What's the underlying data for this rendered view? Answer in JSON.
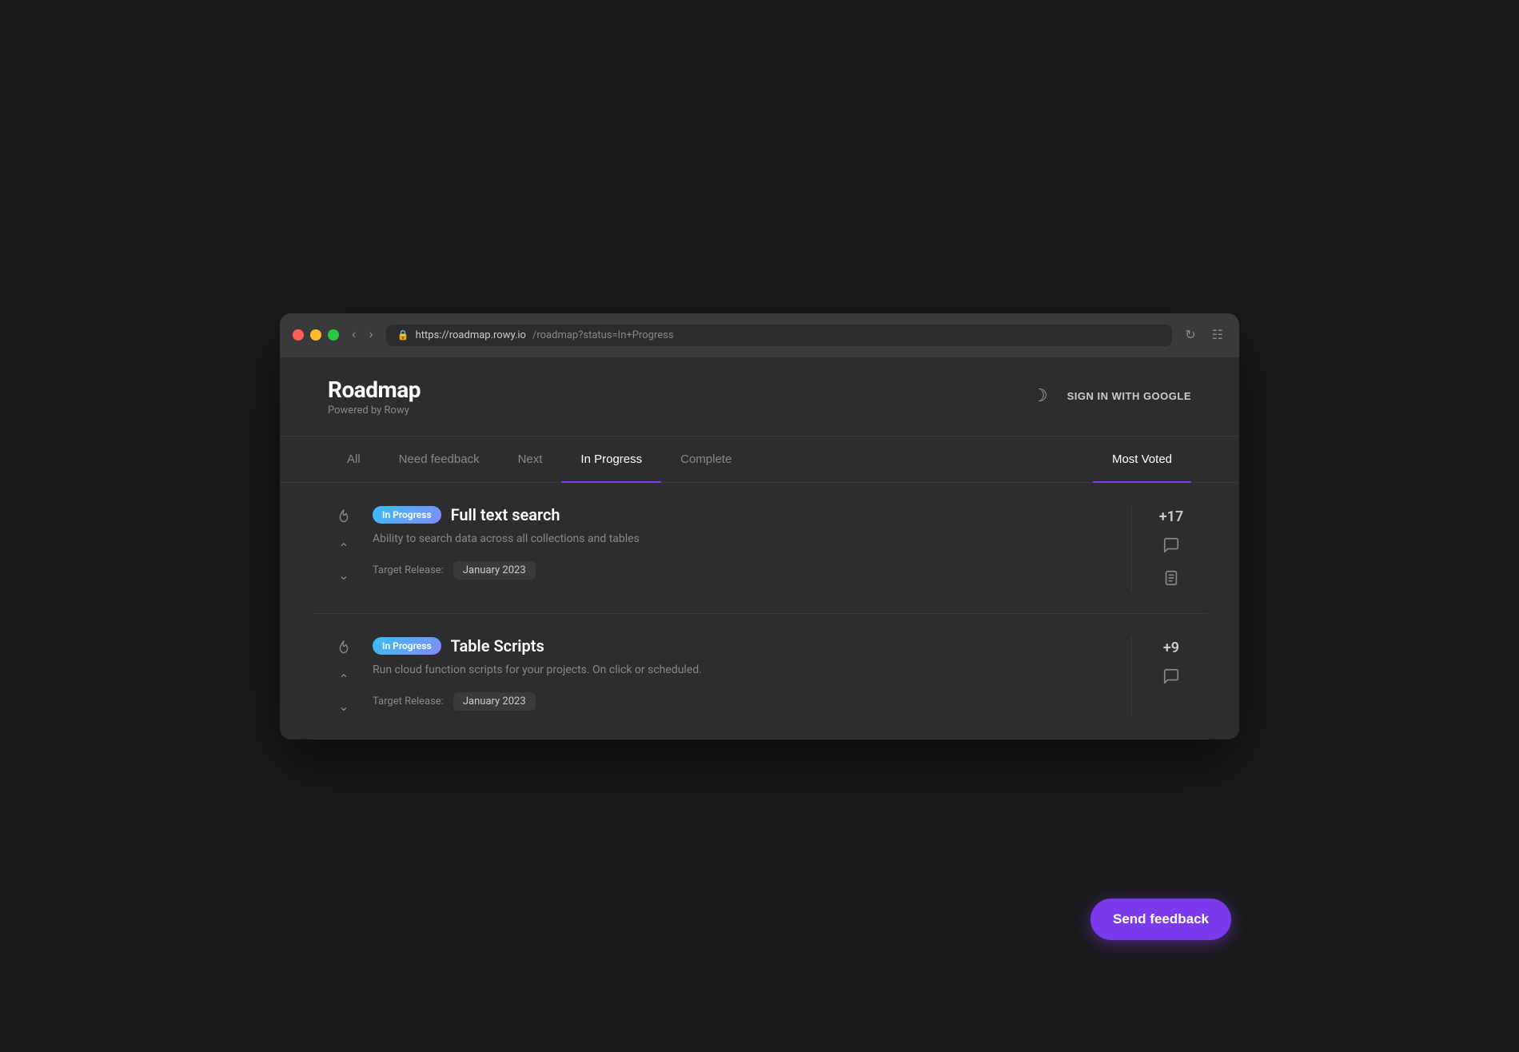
{
  "browser": {
    "url_base": "https://roadmap.rowy.io",
    "url_path": "/roadmap?status=In+Progress",
    "reload_title": "Reload page",
    "tab_grid_title": "Tab overview"
  },
  "header": {
    "brand_title": "Roadmap",
    "brand_subtitle": "Powered by Rowy",
    "sign_in_label": "SIGN IN WITH GOOGLE"
  },
  "nav": {
    "tabs": [
      {
        "id": "all",
        "label": "All",
        "active": false
      },
      {
        "id": "need-feedback",
        "label": "Need feedback",
        "active": false
      },
      {
        "id": "next",
        "label": "Next",
        "active": false
      },
      {
        "id": "in-progress",
        "label": "In Progress",
        "active": true
      },
      {
        "id": "complete",
        "label": "Complete",
        "active": false
      },
      {
        "id": "most-voted",
        "label": "Most Voted",
        "active": false,
        "right": true
      }
    ]
  },
  "items": [
    {
      "id": "full-text-search",
      "status_label": "In Progress",
      "title": "Full text search",
      "description": "Ability to search data across all collections and tables",
      "target_label": "Target Release:",
      "target_date": "January 2023",
      "vote_count": "+17"
    },
    {
      "id": "table-scripts",
      "status_label": "In Progress",
      "title": "Table Scripts",
      "description": "Run cloud function scripts for your projects. On click or scheduled.",
      "target_label": "Target Release:",
      "target_date": "January 2023",
      "vote_count": "+9"
    }
  ],
  "send_feedback": {
    "label": "Send feedback"
  }
}
